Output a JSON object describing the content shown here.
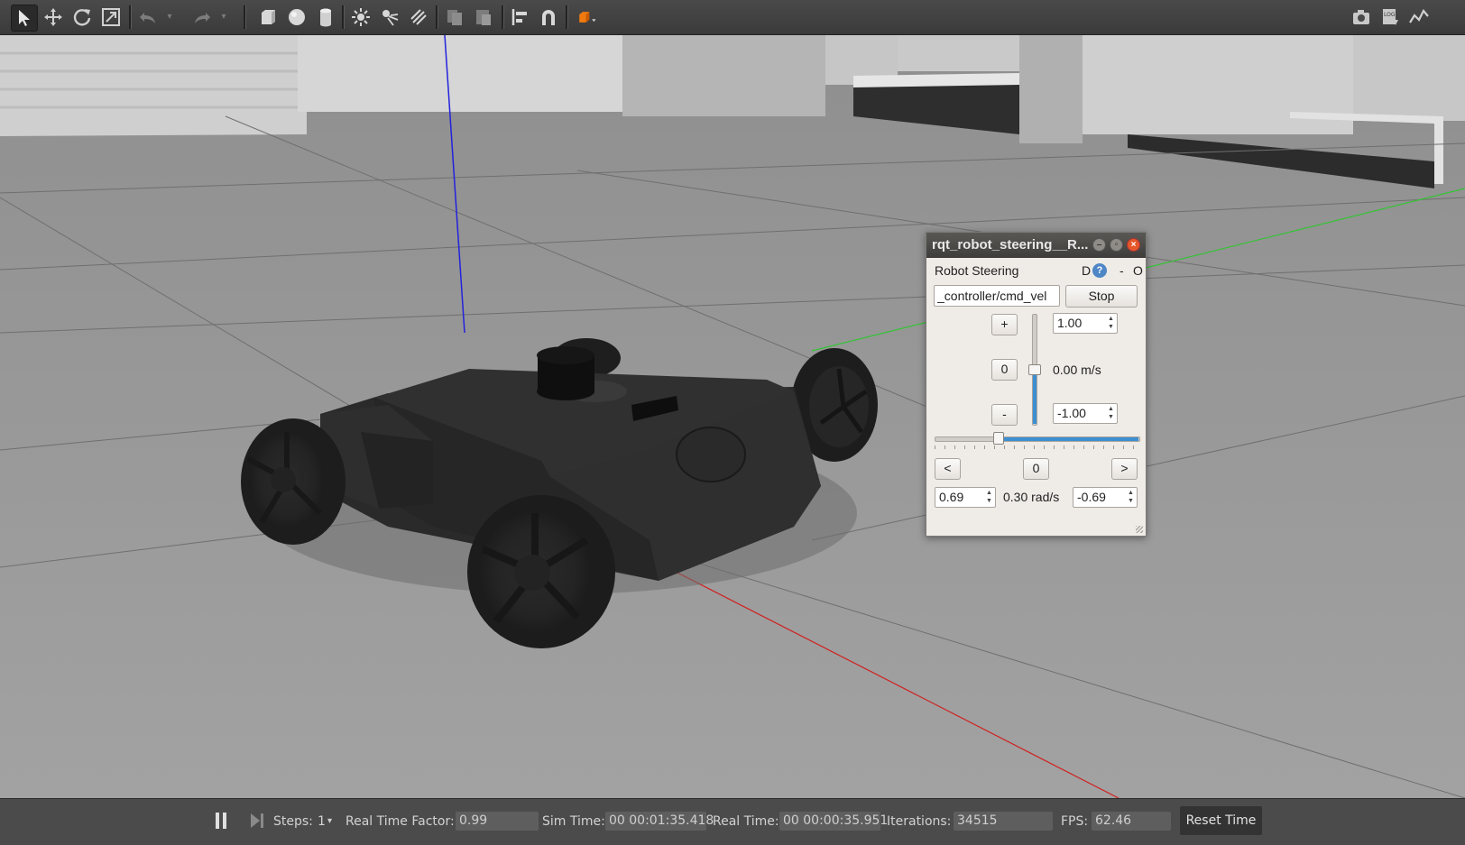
{
  "toolbar": {
    "left_tools": [
      "select-arrow-icon",
      "translate-icon",
      "rotate-icon",
      "scale-icon",
      "undo-icon",
      "undo-dropdown-icon",
      "redo-icon",
      "redo-dropdown-icon",
      "box-shape-icon",
      "sphere-shape-icon",
      "cylinder-shape-icon",
      "point-light-icon",
      "spot-light-icon",
      "directional-light-icon",
      "copy-icon",
      "paste-icon",
      "align-icon",
      "magnet-snap-icon",
      "view-angle-icon"
    ],
    "right_tools": [
      "screenshot-icon",
      "log-icon",
      "plot-icon"
    ]
  },
  "dialog": {
    "title": "rqt_robot_steering__R...",
    "plugin_name": "Robot Steering",
    "plugin_controls": {
      "d": "D",
      "help": "?",
      "minimize": "-",
      "close": "O"
    },
    "topic": "_controller/cmd_vel",
    "stop_label": "Stop",
    "linear": {
      "plus_label": "+",
      "zero_label": "0",
      "minus_label": "-",
      "max_value": "1.00",
      "min_value": "-1.00",
      "current": "0.00 m/s",
      "slider_fraction": 0.5
    },
    "angular": {
      "left_label": "<",
      "zero_label": "0",
      "right_label": ">",
      "max_value": "0.69",
      "min_value": "-0.69",
      "current": "0.30 rad/s",
      "slider_fraction": 0.3
    }
  },
  "status": {
    "steps_label": "Steps:",
    "steps_value": "1",
    "rtf_label": "Real Time Factor:",
    "rtf_value": "0.99",
    "sim_time_label": "Sim Time:",
    "sim_time_value": "00 00:01:35.418",
    "real_time_label": "Real Time:",
    "real_time_value": "00 00:00:35.951",
    "iterations_label": "Iterations:",
    "iterations_value": "34515",
    "fps_label": "FPS:",
    "fps_value": "62.46",
    "reset_label": "Reset Time"
  },
  "colors": {
    "toolbar_bg": "#424242",
    "ground": "#9c9c9c",
    "robot_body": "#2b2b2b",
    "axis_x": "#d02020",
    "axis_y": "#30c030",
    "axis_z": "#2020e0",
    "accent_orange": "#f07a10"
  }
}
